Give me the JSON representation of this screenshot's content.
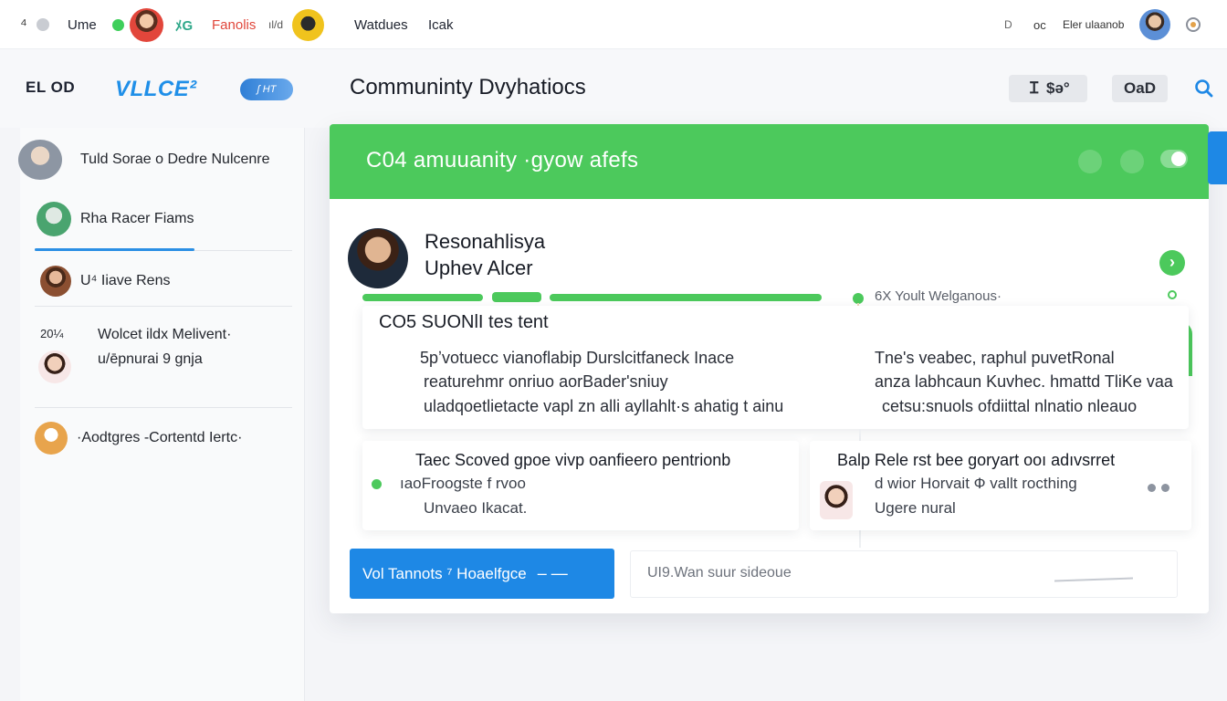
{
  "topbar": {
    "left_glyph": "⁴",
    "user_label": "Ume",
    "app_label_teal": "ﾒG",
    "app_label_red": "Fanolis",
    "app_label_small": "ıl/d",
    "menu_1": "Watdues",
    "menu_2": "Icak",
    "right_1": "D",
    "right_2": "oc",
    "right_3": "Eler ulaanob"
  },
  "brand": {
    "left": "EL OD",
    "logo": "VLLCE²",
    "pill": "ʃ HT"
  },
  "header": {
    "title": "Communinty Dvyhatiocs",
    "btn_1": "Ｉ $ə°",
    "btn_2": "OaD"
  },
  "sidebar": {
    "items": [
      {
        "label": "Tuld Sorae o Dedre Nulcenre"
      },
      {
        "label": "Rha Racer Fiams"
      },
      {
        "label": "U⁴ Iiave Rens"
      },
      {
        "prefix": "20¼",
        "label": "Wolcet ildx  Melivent·",
        "sub": "u/ēpnurai 9 gnja"
      },
      {
        "label": "·Aodtgres   -Cortentd Iertc·"
      }
    ]
  },
  "card": {
    "banner_title": "C04  amuuanity ·gyow  afefs",
    "profile": {
      "line_1": "Resonahlisya",
      "line_2": "Uphev    Alcer"
    },
    "side_label": "6X Yoult Welganous·",
    "panel": {
      "title": "CO5 SUONlI tes tent",
      "left_lines": [
        "5pʼvotuecc vianoflabip Durslcitfaneck Inace",
        "reaturehmr onriuo aorBader'sniuy",
        "uladqoetlietacte vapl zn alli ayllahlt·s ahatig t ainu"
      ],
      "right_lines": [
        "Tne's veabec, raphul puvetRonal",
        "anza labhcaun Kuvhec. hmattd TliKe vaa",
        "cetsu:snuols ofdiittal nlnatio nleauo"
      ]
    },
    "mini_1": {
      "title": "Taec Scoved gpoe vivp oanfieero pentrionb",
      "line_1": "ıaoFroogste f rvoo",
      "line_2": "Unvaeo Ikacat."
    },
    "mini_2": {
      "title": "Balp Rele rst bee goryart ooı adıvsrret",
      "line_1": "d wior  Horvait Ф vallt rocthing",
      "line_2": "Ugere nural"
    },
    "primary_button": "Vol Tannots  ⁷  Hoaelfgce",
    "input_placeholder": "UI9.Wan suur sideoue"
  }
}
